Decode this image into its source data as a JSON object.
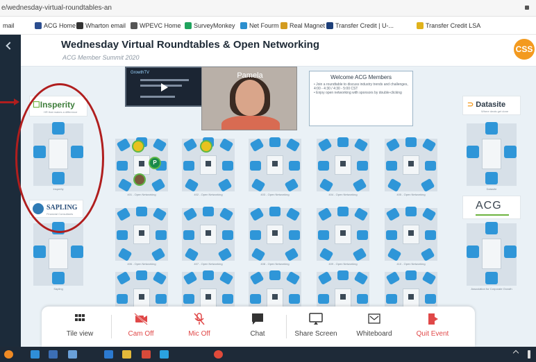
{
  "browser": {
    "url": "e/wednesday-virtual-roundtables-an",
    "bookmarks": [
      {
        "label": "mail",
        "color": "#777777"
      },
      {
        "label": "ACG Home",
        "color": "#2b4d8f"
      },
      {
        "label": "Wharton email",
        "color": "#333333"
      },
      {
        "label": "WPEVC Home",
        "color": "#555555"
      },
      {
        "label": "SurveyMonkey",
        "color": "#1fa35d"
      },
      {
        "label": "Net Fourm",
        "color": "#2c8fcf"
      },
      {
        "label": "Real Magnet",
        "color": "#d39b1f"
      },
      {
        "label": "Transfer Credit | U-...",
        "color": "#1d3f79"
      },
      {
        "label": "Transfer Credit LSA",
        "color": "#e0b21b"
      }
    ]
  },
  "event": {
    "title": "Wednesday Virtual Roundtables & Open Networking",
    "subtitle": "ACG Member Summit 2020",
    "badge": "CSS"
  },
  "presenter": {
    "name": "Pamela"
  },
  "welcome": {
    "heading": "Welcome ACG Members",
    "lines": [
      "• Join a roundtable to discuss industry trends and challenges, 4:00 - 4:30 / 4:30 - 5:00 CST",
      "• Enjoy open networking with sponsors by double-clicking"
    ]
  },
  "sponsors": {
    "insperity": {
      "name": "Insperity",
      "tagline": "HR that makes a difference",
      "room_label": "Insperity"
    },
    "sapling": {
      "name": "SAPLING",
      "tagline": "Financial Consultants",
      "room_label": "Sapling"
    },
    "datasite": {
      "name": "Datasite",
      "tagline": "Where deals get done",
      "room_label": "Datasite"
    },
    "acg": {
      "name": "ACG",
      "room_label": "Association for Corporate Growth"
    }
  },
  "rooms": [
    {
      "label": "401 - Open Networking"
    },
    {
      "label": "402 - Open Networking"
    },
    {
      "label": "403 - Open Networking"
    },
    {
      "label": "404 - Open Networking"
    },
    {
      "label": "405 - Open Networking"
    },
    {
      "label": "406 - Open Networking"
    },
    {
      "label": "407 - Open Networking"
    },
    {
      "label": "408 - Open Networking"
    },
    {
      "label": "409 - Open Networking"
    },
    {
      "label": "410 - Open Networking"
    },
    {
      "label": ""
    },
    {
      "label": ""
    },
    {
      "label": ""
    },
    {
      "label": ""
    },
    {
      "label": ""
    }
  ],
  "avatars": {
    "p_initial": "P"
  },
  "toolbar": {
    "tile_view": "Tile view",
    "cam_off": "Cam Off",
    "mic_off": "Mic Off",
    "chat": "Chat",
    "share_screen": "Share Screen",
    "whiteboard": "Whiteboard",
    "quit_event": "Quit Event"
  },
  "colors": {
    "accent_blue": "#2f96d8",
    "danger_red": "#e04848",
    "annotation_red": "#b01e1e",
    "badge_orange": "#f39a1f"
  }
}
